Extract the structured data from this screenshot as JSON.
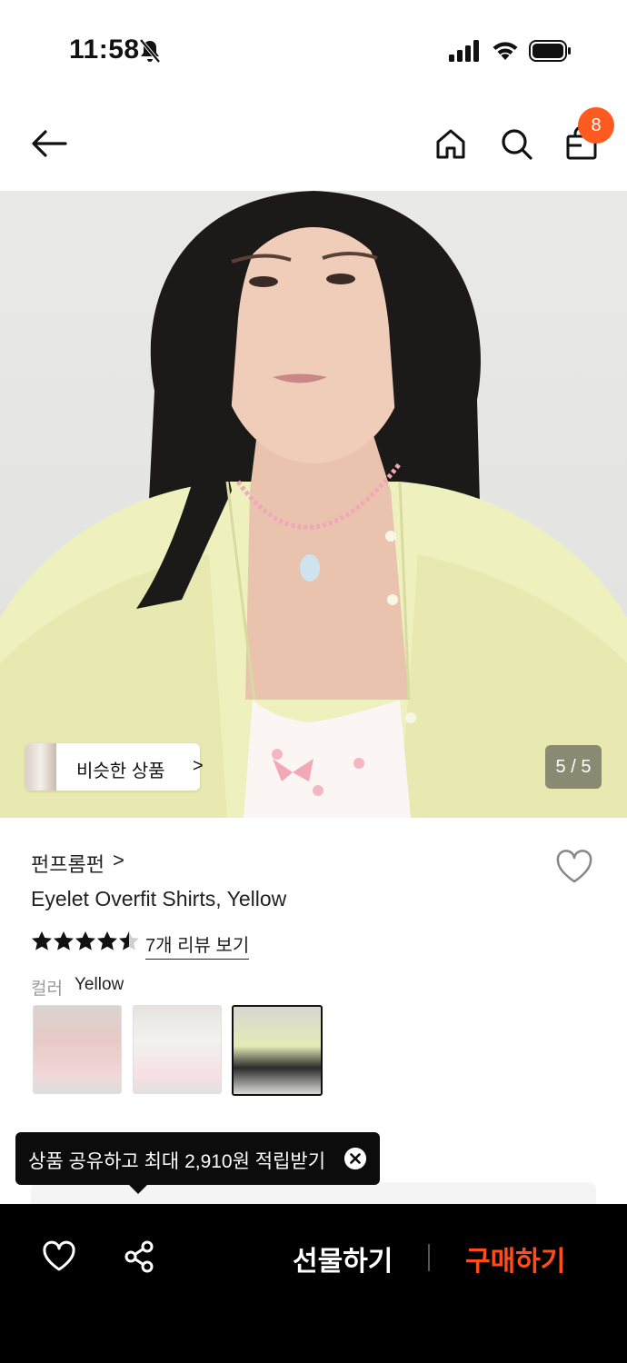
{
  "status_bar": {
    "time": "11:58"
  },
  "top_nav": {
    "cart_count": "8"
  },
  "hero": {
    "similar_label": "비슷한 상품",
    "similar_chevron": ">",
    "image_counter": "5 / 5"
  },
  "product": {
    "brand": "펀프롬펀",
    "brand_chevron": ">",
    "title": "Eyelet Overfit Shirts, Yellow",
    "rating": 4.5,
    "review_link": "7개 리뷰 보기",
    "color_label": "컬러",
    "color_value": "Yellow",
    "color_options": [
      "pink",
      "white",
      "yellow"
    ],
    "selected_color": "yellow"
  },
  "tooltip": {
    "text": "상품 공유하고 최대 2,910원 적립받기"
  },
  "bottom_bar": {
    "gift_label": "선물하기",
    "buy_label": "구매하기"
  },
  "colors": {
    "accent": "#ff4d1a",
    "badge": "#ff5a1f",
    "bottom_bar": "#000000"
  }
}
